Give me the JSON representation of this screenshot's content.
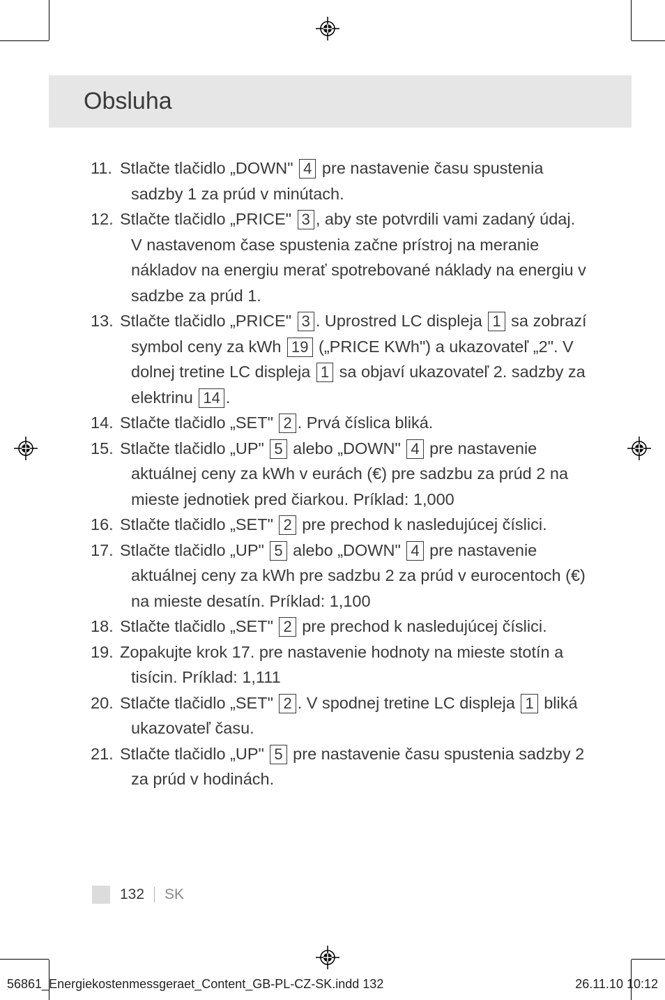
{
  "title": "Obsluha",
  "items": [
    {
      "num": "11.",
      "parts": [
        "Stlačte tlačidlo „DOWN\" ",
        {
          "box": "4"
        },
        " pre nastavenie času spustenia sadzby 1 za prúd v minútach."
      ]
    },
    {
      "num": "12.",
      "parts": [
        "Stlačte tlačidlo „PRICE\" ",
        {
          "box": "3"
        },
        ", aby ste potvrdili vami zadaný údaj. V nastavenom čase spustenia začne prístroj na meranie nákladov na energiu merať spotrebované náklady na energiu v sadzbe za prúd 1."
      ]
    },
    {
      "num": "13.",
      "parts": [
        "Stlačte tlačidlo „PRICE\" ",
        {
          "box": "3"
        },
        ". Uprostred LC displeja ",
        {
          "box": "1"
        },
        " sa zobrazí symbol ceny za kWh ",
        {
          "box": "19"
        },
        " („PRICE KWh\") a ukazovateľ „2\". V dolnej tretine LC displeja ",
        {
          "box": "1"
        },
        " sa objaví ukazovateľ 2. sadzby za elektrinu ",
        {
          "box": "14"
        },
        "."
      ]
    },
    {
      "num": "14.",
      "parts": [
        "Stlačte tlačidlo „SET\" ",
        {
          "box": "2"
        },
        ". Prvá číslica bliká."
      ]
    },
    {
      "num": "15.",
      "parts": [
        "Stlačte tlačidlo „UP\" ",
        {
          "box": "5"
        },
        " alebo „DOWN\" ",
        {
          "box": "4"
        },
        " pre nastavenie aktuálnej ceny za kWh v eurách (€) pre sadzbu za prúd 2 na mieste jednotiek pred čiarkou. Príklad: 1,000"
      ]
    },
    {
      "num": "16.",
      "parts": [
        "Stlačte tlačidlo „SET\" ",
        {
          "box": "2"
        },
        " pre prechod k nasledujúcej číslici."
      ]
    },
    {
      "num": "17.",
      "parts": [
        "Stlačte tlačidlo „UP\" ",
        {
          "box": "5"
        },
        " alebo „DOWN\" ",
        {
          "box": "4"
        },
        " pre nastavenie aktuálnej ceny za kWh pre sadzbu 2 za prúd v eurocentoch (€) na mieste desatín. Príklad: 1,100"
      ]
    },
    {
      "num": "18.",
      "parts": [
        "Stlačte tlačidlo „SET\" ",
        {
          "box": "2"
        },
        " pre prechod k nasledujúcej číslici."
      ]
    },
    {
      "num": "19.",
      "parts": [
        "Zopakujte krok 17. pre nastavenie hodnoty na mieste stotín a tisícin. Príklad: 1,111"
      ]
    },
    {
      "num": "20.",
      "parts": [
        "Stlačte tlačidlo „SET\" ",
        {
          "box": "2"
        },
        ". V spodnej tretine LC displeja ",
        {
          "box": "1"
        },
        " bliká ukazovateľ času."
      ]
    },
    {
      "num": "21.",
      "parts": [
        "Stlačte tlačidlo „UP\" ",
        {
          "box": "5"
        },
        " pre nastavenie času spustenia sadzby 2 za prúd v hodinách."
      ]
    }
  ],
  "footer": {
    "page": "132",
    "lang": "SK"
  },
  "indd": {
    "file": "56861_Energiekostenmessgeraet_Content_GB-PL-CZ-SK.indd   132",
    "stamp": "26.11.10   10:12"
  }
}
